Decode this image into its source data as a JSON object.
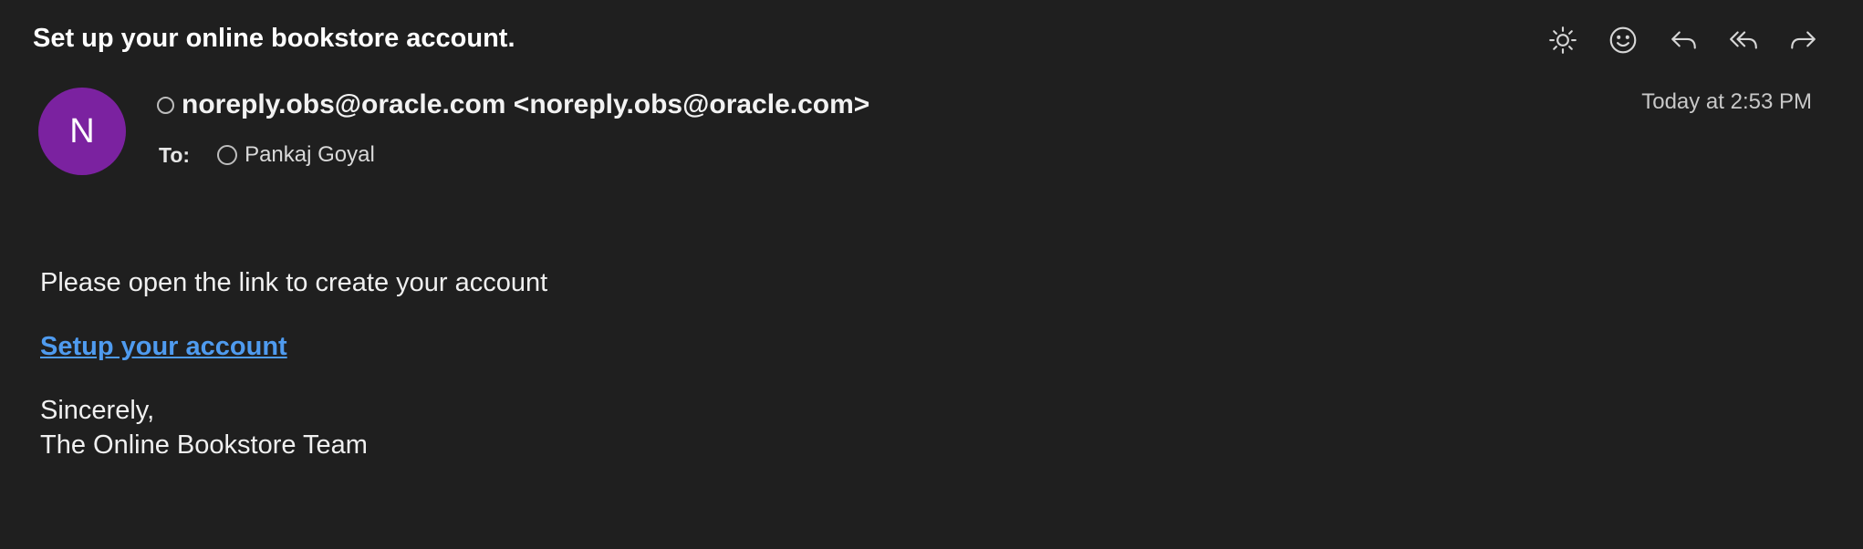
{
  "message": {
    "subject": "Set up your online bookstore account.",
    "sender_display": "noreply.obs@oracle.com <noreply.obs@oracle.com>",
    "avatar_initial": "N",
    "timestamp": "Today at 2:53 PM",
    "to_label": "To:",
    "recipient": "Pankaj Goyal"
  },
  "toolbar": {
    "icons": [
      "brightness-icon",
      "emoji-reaction-icon",
      "reply-icon",
      "reply-all-icon",
      "forward-icon"
    ]
  },
  "body": {
    "line1": "Please open the link to create your account",
    "link_text": "Setup your account",
    "signoff": "Sincerely,",
    "signature": "The Online Bookstore Team"
  },
  "colors": {
    "background": "#1f1f1f",
    "avatar": "#7b22a0",
    "link": "#4f9bef"
  }
}
